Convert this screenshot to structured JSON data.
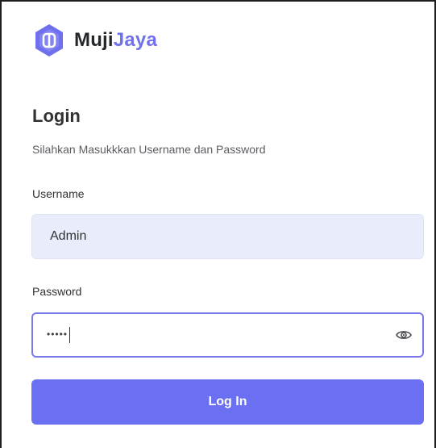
{
  "brand": {
    "name_part1": "Muji",
    "name_part2": "Jaya",
    "logo_icon": "hexagon-logo-icon",
    "accent_color": "#6f70ee"
  },
  "login": {
    "title": "Login",
    "subtitle": "Silahkan Masukkkan Username dan Password"
  },
  "username": {
    "label": "Username",
    "value": "Admin"
  },
  "password": {
    "label": "Password",
    "masked_value": "•••••",
    "visibility_icon": "eye-icon"
  },
  "actions": {
    "login_label": "Log In",
    "button_color": "#6b6ff2"
  }
}
